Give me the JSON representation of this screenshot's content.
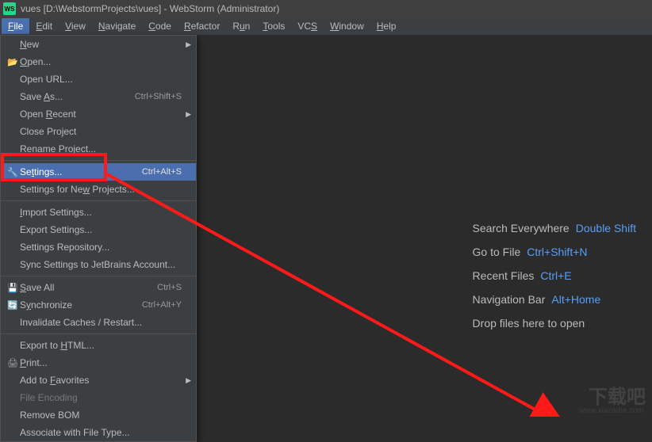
{
  "title": "vues [D:\\WebstormProjects\\vues] - WebStorm (Administrator)",
  "logo_text": "WS",
  "menubar": [
    {
      "label": "File",
      "mn": "F",
      "rest": "ile",
      "active": true
    },
    {
      "label": "Edit",
      "mn": "E",
      "rest": "dit"
    },
    {
      "label": "View",
      "mn": "V",
      "rest": "iew"
    },
    {
      "label": "Navigate",
      "mn": "N",
      "rest": "avigate"
    },
    {
      "label": "Code",
      "mn": "C",
      "rest": "ode"
    },
    {
      "label": "Refactor",
      "mn": "R",
      "rest": "efactor"
    },
    {
      "label": "Run",
      "mn": "",
      "rest": "R",
      "mn2": "u",
      "rest2": "n"
    },
    {
      "label": "Tools",
      "mn": "T",
      "rest": "ools"
    },
    {
      "label": "VCS",
      "mn": "",
      "rest": "VC",
      "mn2": "S",
      "rest2": ""
    },
    {
      "label": "Window",
      "mn": "W",
      "rest": "indow"
    },
    {
      "label": "Help",
      "mn": "H",
      "rest": "elp"
    }
  ],
  "file_menu": {
    "new": "New",
    "open": "Open...",
    "open_url": "Open URL...",
    "save_as": "Save As...",
    "save_as_sc": "Ctrl+Shift+S",
    "open_recent": "Open Recent",
    "close_project": "Close Project",
    "rename_project": "Rename Project...",
    "settings": "Settings...",
    "settings_sc": "Ctrl+Alt+S",
    "settings_new": "Settings for New Projects...",
    "import_settings": "Import Settings...",
    "export_settings": "Export Settings...",
    "settings_repo": "Settings Repository...",
    "sync_jb": "Sync Settings to JetBrains Account...",
    "save_all": "Save All",
    "save_all_sc": "Ctrl+S",
    "synchronize": "Synchronize",
    "synchronize_sc": "Ctrl+Alt+Y",
    "invalidate": "Invalidate Caches / Restart...",
    "export_html": "Export to HTML...",
    "print": "Print...",
    "add_fav": "Add to Favorites",
    "file_encoding": "File Encoding",
    "remove_bom": "Remove BOM",
    "assoc_ft": "Associate with File Type..."
  },
  "welcome": {
    "search": "Search Everywhere",
    "search_k": "Double Shift",
    "gotofile": "Go to File",
    "gotofile_k": "Ctrl+Shift+N",
    "recent": "Recent Files",
    "recent_k": "Ctrl+E",
    "navbar": "Navigation Bar",
    "navbar_k": "Alt+Home",
    "drop": "Drop files here to open"
  },
  "watermark": "下载吧",
  "watermark_url": "www.xiazaiba.com"
}
